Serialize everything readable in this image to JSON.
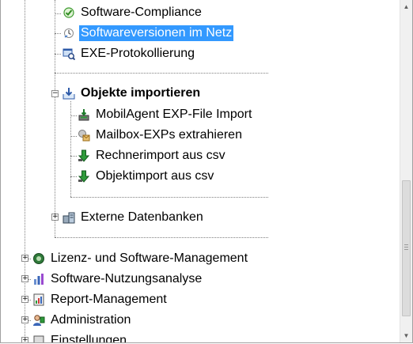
{
  "tree": {
    "items": [
      {
        "label": "Software-Compliance",
        "icon": "check-icon"
      },
      {
        "label": "Softwareversionen im Netz",
        "icon": "version-scan-icon",
        "selected": true
      },
      {
        "label": "EXE-Protokollierung",
        "icon": "exe-log-icon"
      },
      {
        "label": "Objekte importieren",
        "icon": "import-icon",
        "expanded": true
      },
      {
        "label": "MobilAgent EXP-File Import",
        "icon": "mobile-agent-icon"
      },
      {
        "label": "Mailbox-EXPs extrahieren",
        "icon": "mailbox-icon"
      },
      {
        "label": "Rechnerimport aus csv",
        "icon": "green-arrow-down-icon"
      },
      {
        "label": "Objektimport aus csv",
        "icon": "green-arrow-down-icon"
      },
      {
        "label": "Externe Datenbanken",
        "icon": "database-icon",
        "expanded": false
      },
      {
        "label": "Lizenz- und Software-Management",
        "icon": "license-icon",
        "expanded": false
      },
      {
        "label": "Software-Nutzungsanalyse",
        "icon": "usage-analysis-icon",
        "expanded": false
      },
      {
        "label": "Report-Management",
        "icon": "report-icon",
        "expanded": false
      },
      {
        "label": "Administration",
        "icon": "admin-icon",
        "expanded": false
      },
      {
        "label": "Einstellungen",
        "icon": "settings-icon",
        "expanded": false
      }
    ],
    "expander_collapsed": "+",
    "expander_expanded": "−"
  },
  "colors": {
    "selection": "#3399ff",
    "selection_text": "#ffffff",
    "tree_lines": "#808080"
  },
  "scrollbar": {
    "arrow_up": "▲",
    "arrow_down": "▼"
  }
}
